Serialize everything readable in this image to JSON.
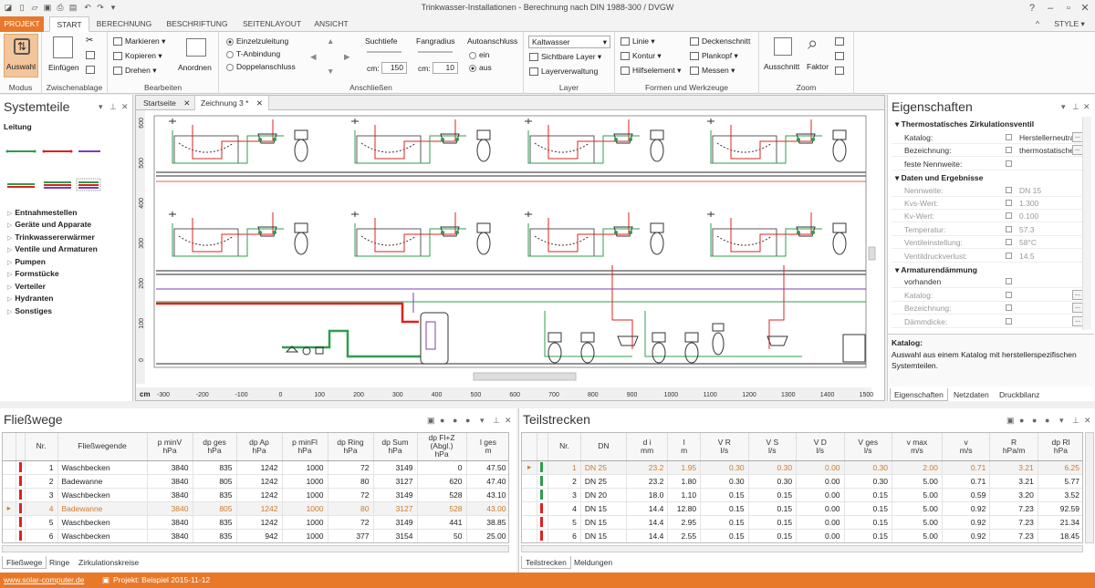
{
  "window": {
    "title": "Trinkwasser-Installationen - Berechnung nach DIN 1988-300 / DVGW"
  },
  "ribbon_tabs": [
    "PROJEKT",
    "START",
    "BERECHNUNG",
    "BESCHRIFTUNG",
    "SEITENLAYOUT",
    "ANSICHT"
  ],
  "style_label": "STYLE",
  "ribbon": {
    "modus": {
      "button": "Auswahl",
      "label": "Modus"
    },
    "clipboard": {
      "paste": "Einfügen",
      "label": "Zwischenablage"
    },
    "edit": {
      "items": [
        "Markieren",
        "Kopieren",
        "Drehen"
      ],
      "arrange": "Anordnen",
      "label": "Bearbeiten"
    },
    "connect": {
      "options": [
        "Einzelzuleitung",
        "T-Anbindung",
        "Doppelanschluss"
      ],
      "search_label": "Suchtiefe",
      "search_unit": "cm:",
      "search_value": "150",
      "radius_label": "Fangradius",
      "radius_unit": "cm:",
      "radius_value": "10",
      "auto_label": "Autoanschluss",
      "auto_on": "ein",
      "auto_off": "aus",
      "label": "Anschließen"
    },
    "layer": {
      "select": "Kaltwasser",
      "visible": "Sichtbare Layer",
      "manage": "Layerverwaltung",
      "label": "Layer"
    },
    "forms": {
      "items": [
        "Linie",
        "Kontur",
        "Hilfselement",
        "Deckenschnitt",
        "Plankopf",
        "Messen"
      ],
      "label": "Formen und Werkzeuge"
    },
    "zoom": {
      "cutout": "Ausschnitt",
      "factor": "Faktor",
      "label": "Zoom"
    }
  },
  "left_panel": {
    "title": "Systemteile",
    "leitung": "Leitung",
    "categories": [
      "Entnahmestellen",
      "Geräte und Apparate",
      "Trinkwassererwärmer",
      "Ventile und Armaturen",
      "Pumpen",
      "Formstücke",
      "Verteiler",
      "Hydranten",
      "Sonstiges"
    ]
  },
  "doc_tabs": [
    "Startseite",
    "Zeichnung 3 *"
  ],
  "ruler": {
    "unit": "cm",
    "x_ticks": [
      "-300",
      "-200",
      "-100",
      "0",
      "100",
      "200",
      "300",
      "400",
      "500",
      "600",
      "700",
      "800",
      "900",
      "1000",
      "1100",
      "1200",
      "1300",
      "1400",
      "1500"
    ],
    "y_ticks": [
      "600",
      "500",
      "400",
      "300",
      "200",
      "100",
      "0"
    ]
  },
  "properties": {
    "title": "Eigenschaften",
    "component": "Thermostatisches Zirkulationsventil",
    "rows1": [
      {
        "k": "Katalog:",
        "v": "Herstellerneutral"
      },
      {
        "k": "Bezeichnung:",
        "v": "thermostatisches"
      },
      {
        "k": "feste Nennweite:",
        "v": ""
      }
    ],
    "section2": "Daten und Ergebnisse",
    "rows2": [
      {
        "k": "Nennweite:",
        "v": "DN 15"
      },
      {
        "k": "Kvs-Wert:",
        "v": "1.300"
      },
      {
        "k": "Kv-Wert:",
        "v": "0.100"
      },
      {
        "k": "Temperatur:",
        "v": "57.3"
      },
      {
        "k": "Ventileinstellung:",
        "v": "58°C"
      },
      {
        "k": "Ventildruckverlust:",
        "v": "14.5"
      }
    ],
    "section3": "Armaturendämmung",
    "rows3": [
      {
        "k": "vorhanden",
        "v": ""
      },
      {
        "k": "Katalog:",
        "v": ""
      },
      {
        "k": "Bezeichnung:",
        "v": ""
      },
      {
        "k": "Dämmdicke:",
        "v": ""
      }
    ],
    "help_title": "Katalog:",
    "help_text": "Auswahl aus einem Katalog mit herstellerspezifischen Systemteilen.",
    "tabs": [
      "Eigenschaften",
      "Netzdaten",
      "Druckbilanz"
    ]
  },
  "fliesswege": {
    "title": "Fließwege",
    "columns": [
      "Nr.",
      "Fließwegende",
      "p minV\nhPa",
      "dp ges\nhPa",
      "dp Ap\nhPa",
      "p minFl\nhPa",
      "dp Ring\nhPa",
      "dp Sum\nhPa",
      "dp Fl+Z (Abgl.)\nhPa",
      "l ges\nm"
    ],
    "rows": [
      [
        "1",
        "Waschbecken",
        "3840",
        "835",
        "1242",
        "1000",
        "72",
        "3149",
        "0",
        "47.50"
      ],
      [
        "2",
        "Badewanne",
        "3840",
        "805",
        "1242",
        "1000",
        "80",
        "3127",
        "620",
        "47.40"
      ],
      [
        "3",
        "Waschbecken",
        "3840",
        "835",
        "1242",
        "1000",
        "72",
        "3149",
        "528",
        "43.10"
      ],
      [
        "4",
        "Badewanne",
        "3840",
        "805",
        "1242",
        "1000",
        "80",
        "3127",
        "528",
        "43.00"
      ],
      [
        "5",
        "Waschbecken",
        "3840",
        "835",
        "1242",
        "1000",
        "72",
        "3149",
        "441",
        "38.85"
      ],
      [
        "6",
        "Waschbecken",
        "3840",
        "835",
        "942",
        "1000",
        "377",
        "3154",
        "50",
        "25.00"
      ]
    ],
    "tabs": [
      "Fließwege",
      "Ringe",
      "Zirkulationskreise"
    ]
  },
  "teilstrecken": {
    "title": "Teilstrecken",
    "columns": [
      "Nr.",
      "DN",
      "d i\nmm",
      "l\nm",
      "V R\nl/s",
      "V S\nl/s",
      "V D\nl/s",
      "V ges\nl/s",
      "v max\nm/s",
      "v\nm/s",
      "R\nhPa/m",
      "dp Rl\nhPa"
    ],
    "rows": [
      [
        "1",
        "DN 25",
        "23.2",
        "1.95",
        "0.30",
        "0.30",
        "0.00",
        "0.30",
        "2.00",
        "0.71",
        "3.21",
        "6.25"
      ],
      [
        "2",
        "DN 25",
        "23.2",
        "1.80",
        "0.30",
        "0.30",
        "0.00",
        "0.30",
        "5.00",
        "0.71",
        "3.21",
        "5.77"
      ],
      [
        "3",
        "DN 20",
        "18.0",
        "1.10",
        "0.15",
        "0.15",
        "0.00",
        "0.15",
        "5.00",
        "0.59",
        "3.20",
        "3.52"
      ],
      [
        "4",
        "DN 15",
        "14.4",
        "12.80",
        "0.15",
        "0.15",
        "0.00",
        "0.15",
        "5.00",
        "0.92",
        "7.23",
        "92.59"
      ],
      [
        "5",
        "DN 15",
        "14.4",
        "2.95",
        "0.15",
        "0.15",
        "0.00",
        "0.15",
        "5.00",
        "0.92",
        "7.23",
        "21.34"
      ],
      [
        "6",
        "DN 15",
        "14.4",
        "2.55",
        "0.15",
        "0.15",
        "0.00",
        "0.15",
        "5.00",
        "0.92",
        "7.23",
        "18.45"
      ]
    ],
    "tabs": [
      "Teilstrecken",
      "Meldungen"
    ]
  },
  "status": {
    "url": "www.solar-computer.de",
    "project": "Projekt: Beispiel 2015-11-12"
  },
  "colors": {
    "accent": "#e8792a",
    "cold": "#2e9d4f",
    "hot": "#e02020",
    "circ": "#7a3fb5"
  }
}
